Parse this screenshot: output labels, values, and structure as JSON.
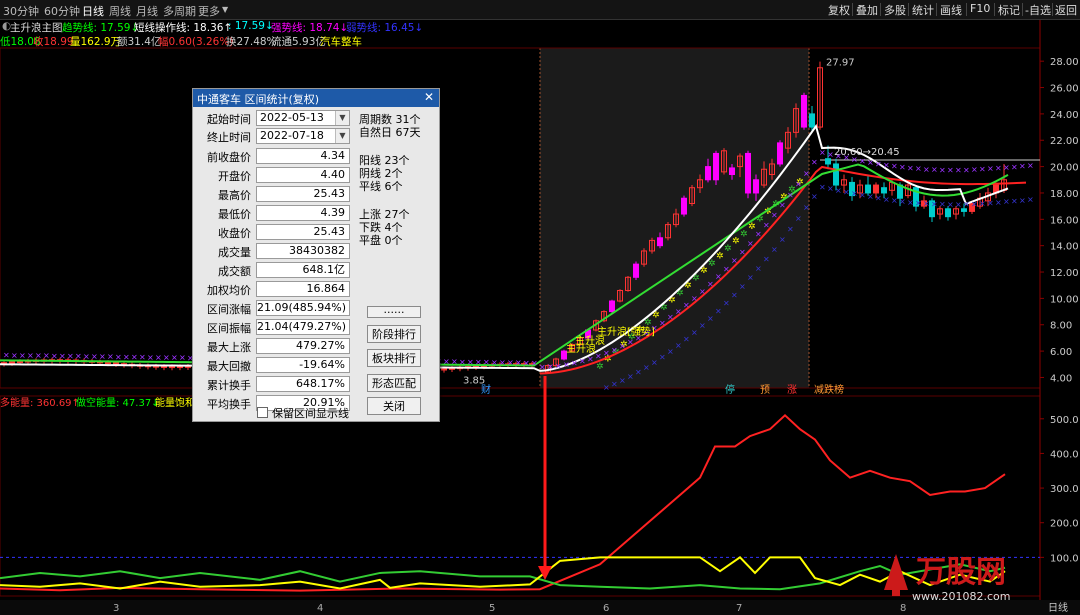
{
  "toolbar": {
    "tabs": [
      "30分钟",
      "60分钟",
      "日线",
      "周线",
      "月线",
      "多周期",
      "更多"
    ],
    "active_tab": "日线",
    "right_buttons": [
      "复权",
      "叠加",
      "多股",
      "统计",
      "画线",
      "F10",
      "标记",
      "-自选",
      "返回"
    ]
  },
  "indicator_line": {
    "name": "主升浪主图",
    "items": [
      {
        "text": "趋势线: 17.59↓",
        "color": "#00ff00"
      },
      {
        "text": "短线操作线: 18.36↑",
        "color": "#ffffff"
      },
      {
        "text": ": 17.59↓",
        "color": "#00ffff"
      },
      {
        "text": "强势线: 18.74↓",
        "color": "#ff00ff"
      },
      {
        "text": "弱势线: 16.45↓",
        "color": "#3333ff"
      }
    ]
  },
  "quote_line": {
    "items": [
      {
        "text": "低18.08",
        "color": "#00ff00"
      },
      {
        "text": "收18.99",
        "color": "#ff3333"
      },
      {
        "text": "量162.9万",
        "color": "#ffff00"
      },
      {
        "text": "额31.4亿",
        "color": "#cccccc"
      },
      {
        "text": "幅0.60(3.26%)",
        "color": "#ff3333"
      },
      {
        "text": "换27.48%",
        "color": "#cccccc"
      },
      {
        "text": "流通5.93亿",
        "color": "#cccccc"
      },
      {
        "text": "汽车整车",
        "color": "#ffff00"
      }
    ]
  },
  "price_axis": [
    "28.00",
    "26.00",
    "24.00",
    "22.00",
    "20.00",
    "18.00",
    "16.00",
    "14.00",
    "12.00",
    "10.00",
    "8.00",
    "6.00",
    "4.00"
  ],
  "indicator_axis": [
    "500.0",
    "400.0",
    "300.0",
    "200.0",
    "100.0"
  ],
  "date_axis": [
    "3",
    "4",
    "5",
    "6",
    "7",
    "8"
  ],
  "chart_labels": {
    "high_price": "27.97",
    "low_price": "3.85",
    "range_mark": "20.60→20.45",
    "signal_1": "主升浪",
    "signal_2": "主升浪",
    "signal_3": "主升浪[强势]",
    "event_tags": [
      "财",
      "停",
      "预",
      "涨",
      "减跌榜"
    ]
  },
  "indicator_legend": {
    "items": [
      {
        "text": "多能量: 360.69↑",
        "color": "#ff3333"
      },
      {
        "text": "做空能量: 47.37↓",
        "color": "#00ff00"
      },
      {
        "text": "能量饱和",
        "color": "#ffff00"
      }
    ]
  },
  "period_label": "日线",
  "watermark": {
    "brand": "万股网",
    "url": "www.201082.com"
  },
  "dialog": {
    "title": "中通客车 区间统计(复权)",
    "start_label": "起始时间",
    "start_value": "2022-05-13",
    "end_label": "终止时间",
    "end_value": "2022-07-18",
    "fields": [
      {
        "label": "前收盘价",
        "value": "4.34"
      },
      {
        "label": "开盘价",
        "value": "4.40"
      },
      {
        "label": "最高价",
        "value": "25.43"
      },
      {
        "label": "最低价",
        "value": "4.39"
      },
      {
        "label": "收盘价",
        "value": "25.43"
      },
      {
        "label": "成交量",
        "value": "38430382"
      },
      {
        "label": "成交额",
        "value": "648.1亿"
      },
      {
        "label": "加权均价",
        "value": "16.864"
      },
      {
        "label": "区间涨幅",
        "value": "21.09(485.94%)"
      },
      {
        "label": "区间振幅",
        "value": "21.04(479.27%)"
      },
      {
        "label": "最大上涨",
        "value": "479.27%"
      },
      {
        "label": "最大回撤",
        "value": "-19.64%"
      },
      {
        "label": "累计换手",
        "value": "648.17%"
      },
      {
        "label": "平均换手",
        "value": "20.91%"
      }
    ],
    "info": [
      "周期数 31个",
      "自然日 67天",
      "阳线 23个",
      "阴线 2个",
      "平线 6个",
      "上涨 27个",
      "下跌 4个",
      "平盘 0个"
    ],
    "buttons": [
      "......",
      "阶段排行",
      "板块排行",
      "形态匹配",
      "关闭"
    ],
    "checkbox_label": "保留区间显示线"
  },
  "chart_data": {
    "type": "candlestick",
    "price_ylim": [
      3.2,
      29.0
    ],
    "indicator_ylim": [
      0,
      560
    ],
    "selection_range": [
      "2022-05-13",
      "2022-07-18"
    ],
    "note_levels": {
      "high": 27.97,
      "low": 3.85
    }
  }
}
